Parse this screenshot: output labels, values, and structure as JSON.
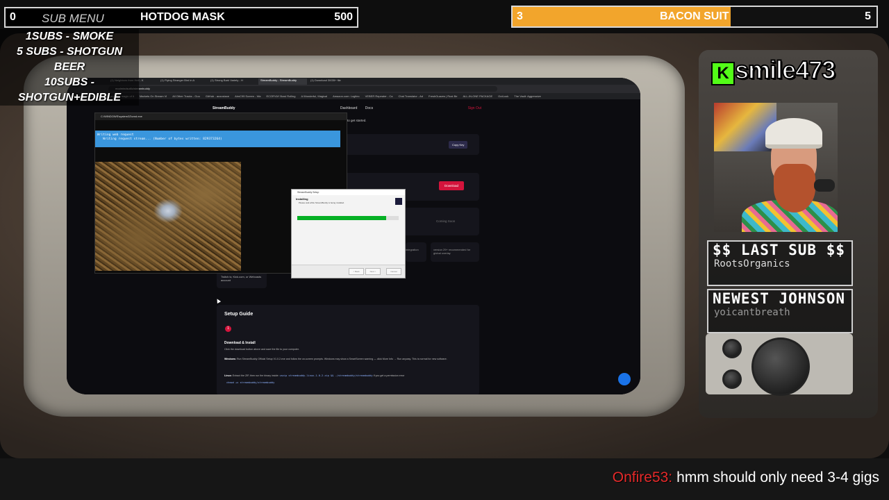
{
  "top_left_goal": {
    "current": "0",
    "title": "HOTDOG MASK",
    "target": "500"
  },
  "top_right_goal": {
    "current": "3",
    "title": "BACON SUIT",
    "target": "5",
    "progress": 0.6,
    "fill_color": "#f2a52c"
  },
  "sub_menu": {
    "heading": "SUB MENU",
    "items": [
      "1SUBS   - SMOKE",
      "5 SUBS  - SHOTGUN BEER",
      "10SUBS - SHOTGUN+EDIBLE"
    ]
  },
  "browser": {
    "tabs": [
      "(1) Neighbors from Hell - K",
      "(1) Flying Stranger Bird in A",
      "(1) Strong Bark Variety - H",
      "StreamBuddy - StreamBuddy",
      "(1) Download 30GB+ file"
    ],
    "address": "modmindsutilo/streambuddy",
    "bookmarks": [
      "Creator Dashboard - K",
      "Vegan 7 the magic of it",
      "Markets On Stream Vi",
      "All Other Tracks - Goo",
      "GitHub - acoustaxe",
      "AimC99 Screen - Wa",
      "ECORYAY Bowl Rolling",
      "A Wonderful, Magical",
      "Amazon.com: Logitec",
      "VEBER Repeater - Ca",
      "Chat Translator - Ad",
      "FreshGuaves | Rust Be",
      "ALL-IN-ONE PACKAGE",
      "OutLook",
      "The Vault: Aggressive"
    ],
    "site": {
      "brand": "StreamBuddy",
      "nav": [
        "Dashboard",
        "Docs"
      ],
      "sign_out": "Sign Out",
      "intro": "to get started.",
      "copy_key": "Copy Key",
      "download": "Download",
      "coming_soon": "Coming Soon",
      "spec1": "11.8M 64B",
      "spec2": "8 GB minimum, 16 GB recommend",
      "spec3": "integration",
      "spec4": "version 29+ recommended for global overlay",
      "platforms_label": "STREAMING PLATFORM",
      "platforms": "Twitch.tv, Kick.com, or Webcasts account",
      "guide_title": "Setup Guide",
      "step_number": "1",
      "step_heading": "Download & Install",
      "step_line1": "Click the download button above and save the file to your computer.",
      "windows_label": "Windows:",
      "windows_text": "Run StreamBuddy Official Setup V1.0.2.exe and follow the on-screen prompts. Windows may show a SmartScreen warning — click More Info → Run anyway. This is normal for new software.",
      "linux_label": "Linux:",
      "linux_text": "Extract the ZIP, then run the binary inside:",
      "linux_code": "unzip streambuddy-linux-1.0.2.zip && ./streambuddy/streambuddy",
      "linux_suffix": "If you get a permission error",
      "chmod_code": "chmod +x streambuddy/streambuddy"
    },
    "cmd": {
      "title": "C:\\WINDOWS\\system32\\cmd.exe",
      "line1": "Writing web request",
      "line2": "   Writing request stream... (Number of bytes written: 829373264)"
    },
    "installer": {
      "title": "StreamBuddy Setup",
      "heading": "Installing",
      "subtitle": "Please wait while StreamBuddy is being installed.",
      "progress": 0.88,
      "buttons": [
        "< Back",
        "Next >",
        "Cancel"
      ]
    }
  },
  "streamer": {
    "platform_icon": "kick-logo-icon",
    "username": "smile473"
  },
  "last_sub": {
    "heading": "$$ LAST SUB $$",
    "name": "RootsOrganics"
  },
  "newest": {
    "heading": "NEWEST JOHNSON",
    "name": "yoicantbreath"
  },
  "chat": {
    "user": "Onfire53:",
    "message": "hmm should only need 3-4 gigs",
    "user_color": "#e52a2a"
  }
}
